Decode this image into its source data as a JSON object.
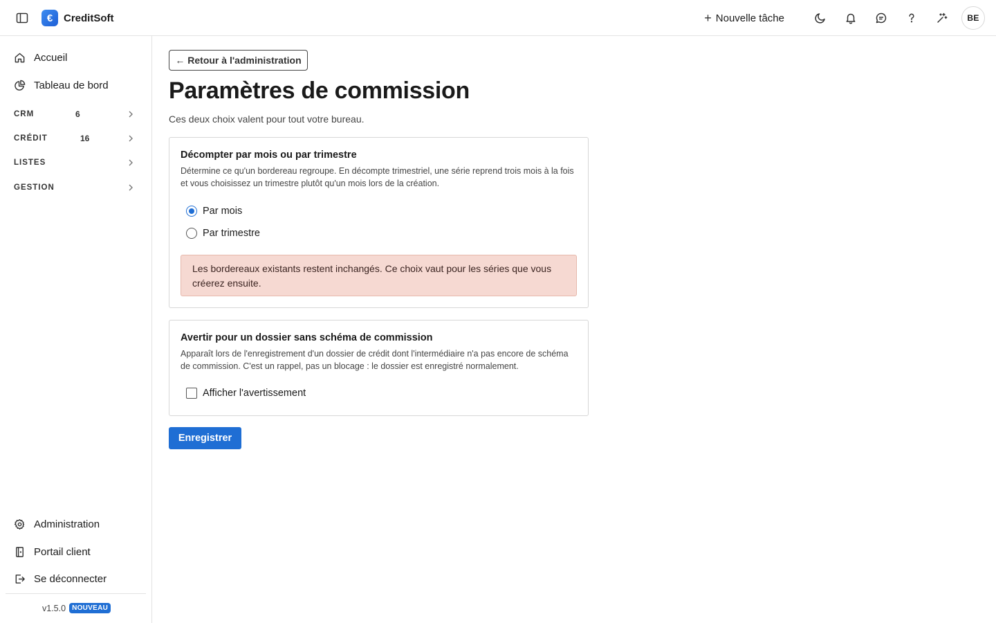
{
  "app": {
    "name": "CreditSoft",
    "logo_glyph": "€",
    "accent": "#1f6ed4"
  },
  "header": {
    "new_task_label": "Nouvelle tâche",
    "avatar_initials": "BE",
    "icons": [
      "moon-icon",
      "bell-icon",
      "chat-icon",
      "help-icon",
      "sparkle-icon"
    ]
  },
  "sidebar": {
    "top_items": [
      {
        "label": "Accueil",
        "icon": "home-icon"
      },
      {
        "label": "Tableau de bord",
        "icon": "chart-pie-icon"
      }
    ],
    "groups": [
      {
        "label": "CRM",
        "count": "6"
      },
      {
        "label": "CRÉDIT",
        "count": "16"
      },
      {
        "label": "LISTES",
        "count": ""
      },
      {
        "label": "GESTION",
        "count": ""
      }
    ],
    "bottom_items": [
      {
        "label": "Administration",
        "icon": "gear-icon"
      },
      {
        "label": "Portail client",
        "icon": "portal-icon"
      },
      {
        "label": "Se déconnecter",
        "icon": "logout-icon"
      }
    ],
    "version": "v1.5.0",
    "version_badge": "NOUVEAU"
  },
  "main": {
    "back_label": "← Retour à l'administration",
    "title": "Paramètres de commission",
    "subtitle": "Ces deux choix valent pour tout votre bureau.",
    "period_card": {
      "title": "Décompter par mois ou par trimestre",
      "description": "Détermine ce qu'un bordereau regroupe. En décompte trimestriel, une série reprend trois mois à la fois et vous choisissez un trimestre plutôt qu'un mois lors de la création.",
      "options": [
        {
          "label": "Par mois",
          "checked": true
        },
        {
          "label": "Par trimestre",
          "checked": false
        }
      ],
      "alert": "Les bordereaux existants restent inchangés. Ce choix vaut pour les séries que vous créerez ensuite."
    },
    "warning_card": {
      "title": "Avertir pour un dossier sans schéma de commission",
      "description": "Apparaît lors de l'enregistrement d'un dossier de crédit dont l'intermédiaire n'a pas encore de schéma de commission. C'est un rappel, pas un blocage : le dossier est enregistré normalement.",
      "checkbox_label": "Afficher l'avertissement",
      "checked": false
    },
    "save_label": "Enregistrer"
  }
}
